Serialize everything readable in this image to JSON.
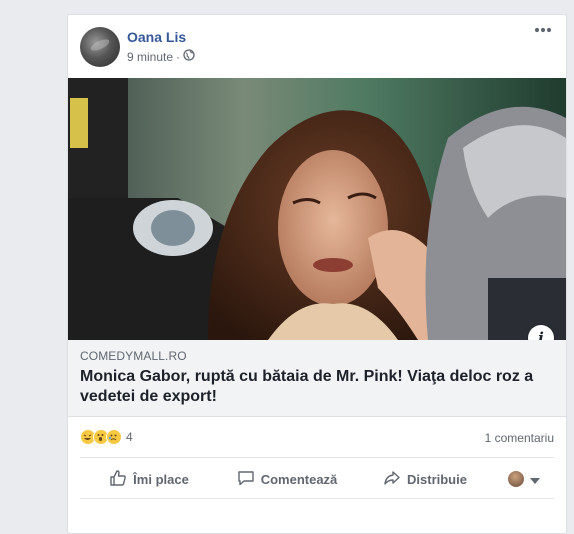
{
  "post": {
    "author": "Oana Lis",
    "time": "9 minute",
    "audience_icon": "globe-icon",
    "more_icon": "more-options-icon"
  },
  "link": {
    "domain": "COMEDYMALL.RO",
    "headline": "Monica Gabor, ruptă cu bătaia de Mr. Pink! Viaţa deloc roz a vedetei de export!",
    "info_label": "i"
  },
  "reactions": {
    "icons": [
      "haha-icon",
      "wow-icon",
      "sad-icon"
    ],
    "count": "4",
    "comments": "1 comentariu"
  },
  "actions": {
    "like": "Îmi place",
    "comment": "Comentează",
    "share": "Distribuie"
  },
  "colors": {
    "author": "#365899",
    "background": "#e9ebee",
    "muted": "#606770"
  }
}
